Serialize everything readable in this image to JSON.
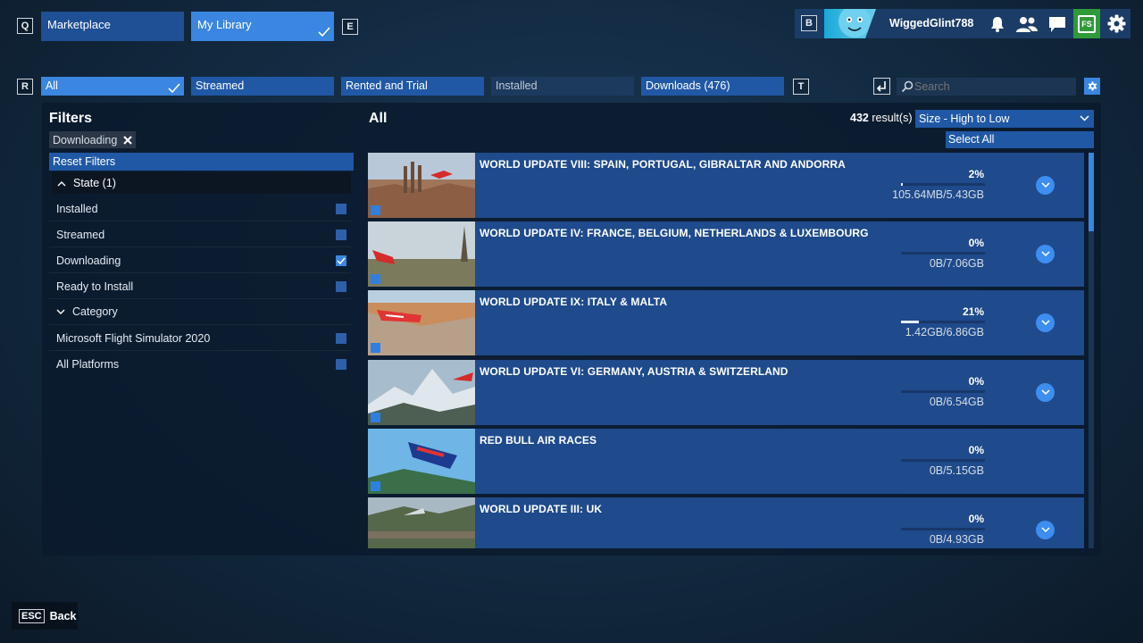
{
  "keys": {
    "q": "Q",
    "e": "E",
    "r": "R",
    "t": "T",
    "b": "B",
    "esc": "ESC"
  },
  "top_tabs": {
    "marketplace": "Marketplace",
    "my_library": "My Library"
  },
  "user": {
    "name": "WiggedGlint788"
  },
  "store_badge": "FS",
  "sub_tabs": [
    {
      "label": "All",
      "active": true
    },
    {
      "label": "Streamed",
      "active": false
    },
    {
      "label": "Rented and Trial",
      "active": false
    },
    {
      "label": "Installed",
      "active": false
    },
    {
      "label": "Downloads (476)",
      "active": false
    }
  ],
  "search": {
    "placeholder": "Search"
  },
  "filters": {
    "title": "Filters",
    "chip": "Downloading",
    "reset": "Reset Filters",
    "state_header": "State (1)",
    "state_items": [
      {
        "label": "Installed",
        "checked": false
      },
      {
        "label": "Streamed",
        "checked": false
      },
      {
        "label": "Downloading",
        "checked": true
      },
      {
        "label": "Ready to Install",
        "checked": false
      }
    ],
    "category_header": "Category",
    "category_items": [
      {
        "label": "Microsoft Flight Simulator 2020",
        "checked": false
      },
      {
        "label": "All Platforms",
        "checked": false
      }
    ]
  },
  "list": {
    "title": "All",
    "results_count": "432",
    "results_suffix": "result(s)",
    "sort": "Size - High to Low",
    "select_all": "Select All",
    "items": [
      {
        "title": "WORLD UPDATE VIII: SPAIN, PORTUGAL, GIBRALTAR AND ANDORRA",
        "percent": "2%",
        "progress": 0.02,
        "size": "105.64MB/5.43GB"
      },
      {
        "title": "WORLD UPDATE IV: FRANCE, BELGIUM, NETHERLANDS & LUXEMBOURG",
        "percent": "0%",
        "progress": 0.0,
        "size": "0B/7.06GB"
      },
      {
        "title": "WORLD UPDATE IX: ITALY & MALTA",
        "percent": "21%",
        "progress": 0.21,
        "size": "1.42GB/6.86GB"
      },
      {
        "title": "WORLD UPDATE VI: GERMANY, AUSTRIA & SWITZERLAND",
        "percent": "0%",
        "progress": 0.0,
        "size": "0B/6.54GB"
      },
      {
        "title": "RED BULL AIR RACES",
        "percent": "0%",
        "progress": 0.0,
        "size": "0B/5.15GB"
      },
      {
        "title": "WORLD UPDATE III: UK",
        "percent": "0%",
        "progress": 0.0,
        "size": "0B/4.93GB"
      }
    ]
  },
  "back": {
    "label": "Back"
  },
  "colors": {
    "accent": "#3a86e0",
    "tab": "#2058a5",
    "row": "#1f4a8c",
    "store": "#2f9a3a"
  }
}
